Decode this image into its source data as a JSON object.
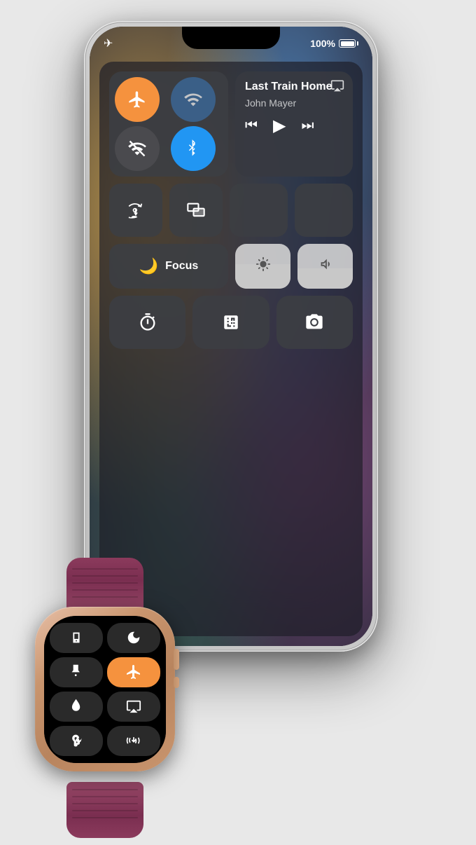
{
  "status_bar": {
    "battery": "100%",
    "battery_full": true,
    "airplane_mode": true
  },
  "now_playing": {
    "title": "Last Train Home",
    "artist": "John Mayer",
    "airplay_icon": "⊕"
  },
  "control_center": {
    "buttons": {
      "airplane": {
        "label": "Airplane Mode",
        "active": true
      },
      "wifi": {
        "label": "Wi-Fi",
        "active": false
      },
      "cellular": {
        "label": "Cellular",
        "active": false
      },
      "bluetooth": {
        "label": "Bluetooth",
        "active": true
      }
    },
    "focus": {
      "label": "Focus",
      "icon": "🌙"
    },
    "brightness": {
      "level": 55
    },
    "volume": {
      "level": 45
    },
    "bottom_buttons": {
      "timer": "Timer",
      "calculator": "Calculator",
      "camera": "Camera"
    }
  },
  "watch": {
    "buttons": [
      {
        "name": "walkie-talkie",
        "icon": "📻"
      },
      {
        "name": "do-not-disturb",
        "icon": "🌙"
      },
      {
        "name": "flashlight",
        "icon": "🔦"
      },
      {
        "name": "airplane-mode",
        "icon": "✈",
        "active": true
      },
      {
        "name": "water-lock",
        "icon": "💧"
      },
      {
        "name": "airplay",
        "icon": "📡"
      },
      {
        "name": "hearing",
        "icon": "👂"
      },
      {
        "name": "haptics",
        "icon": "〰"
      }
    ]
  }
}
